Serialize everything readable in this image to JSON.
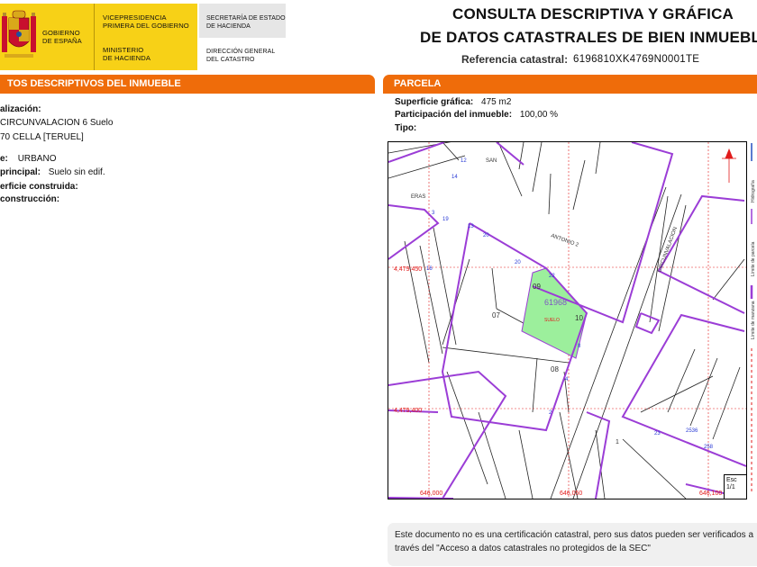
{
  "header": {
    "gov_line1": "GOBIERNO",
    "gov_line2": "DE ESPAÑA",
    "vice_line1": "VICEPRESIDENCIA",
    "vice_line2": "PRIMERA DEL GOBIERNO",
    "min_line1": "MINISTERIO",
    "min_line2": "DE HACIENDA",
    "sec_line1": "SECRETARÍA DE ESTADO",
    "sec_line2": "DE HACIENDA",
    "dir_line1": "DIRECCIÓN GENERAL",
    "dir_line2": "DEL CATASTRO"
  },
  "title": {
    "line1": "CONSULTA DESCRIPTIVA Y GRÁFICA",
    "line2": "DE DATOS CATASTRALES DE BIEN INMUEBLE",
    "ref_label": "Referencia catastral:",
    "ref_value": "6196810XK4769N0001TE"
  },
  "left_section": {
    "title": "TOS DESCRIPTIVOS DEL INMUEBLE",
    "localizacion_label": "alización:",
    "address_line1": "CIRCUNVALACION 6 Suelo",
    "address_line2": "70 CELLA [TERUEL]",
    "clase_label": "e:",
    "clase_value": "URBANO",
    "uso_label": "principal:",
    "uso_value": "Suelo sin edif.",
    "superficie_label": "erficie construida:",
    "anio_label": "construcción:"
  },
  "right_section": {
    "title": "PARCELA",
    "superficie_label": "Superficie gráfica:",
    "superficie_value": "475 m2",
    "participacion_label": "Participación del inmueble:",
    "participacion_value": "100,00 %",
    "tipo_label": "Tipo:"
  },
  "map": {
    "street_san": "SAN",
    "street_eras": "ERAS",
    "street_antonio": "ANTONIO 2",
    "street_circunvalacion": "CIRCUNVALACION",
    "parcel_ref": "61968",
    "parcel_suelo": "SUELO",
    "plot_07": "07",
    "plot_08": "08",
    "plot_09": "09",
    "plot_10": "10",
    "plot_1": "1",
    "coord_y1": "4,479,450",
    "coord_y2": "4,479,400",
    "coord_x1": "646,000",
    "coord_x2": "646,050",
    "coord_x3": "646,100",
    "num_12": "12",
    "num_14": "14",
    "num_3": "3",
    "num_19": "19",
    "num_13": "13",
    "num_20": "20",
    "num_16": "16",
    "num_22": "22",
    "num_20b": "20",
    "num_8": "8",
    "num_4": "4",
    "num_2": "2",
    "num_23": "23",
    "num_2536": "2536",
    "num_258": "258",
    "scale_label": "Esc",
    "scale_value": "1/1"
  },
  "legend": {
    "hidrografia": "Hidrografía",
    "limite_parcela": "Límite de parcela",
    "limite_manzana": "Límite de manzana"
  },
  "footer": {
    "note_line1": "Este documento no es una certificación catastral, pero sus datos pueden ser verificados a",
    "note_line2": "través del \"Acceso a datos catastrales no protegidos de la SEC\""
  },
  "colors": {
    "accent_orange": "#ef6c0a",
    "gov_yellow": "#f7d117",
    "parcel_green": "#9cef9c",
    "block_purple": "#9b3dd6",
    "coord_red": "#e11b1b"
  }
}
